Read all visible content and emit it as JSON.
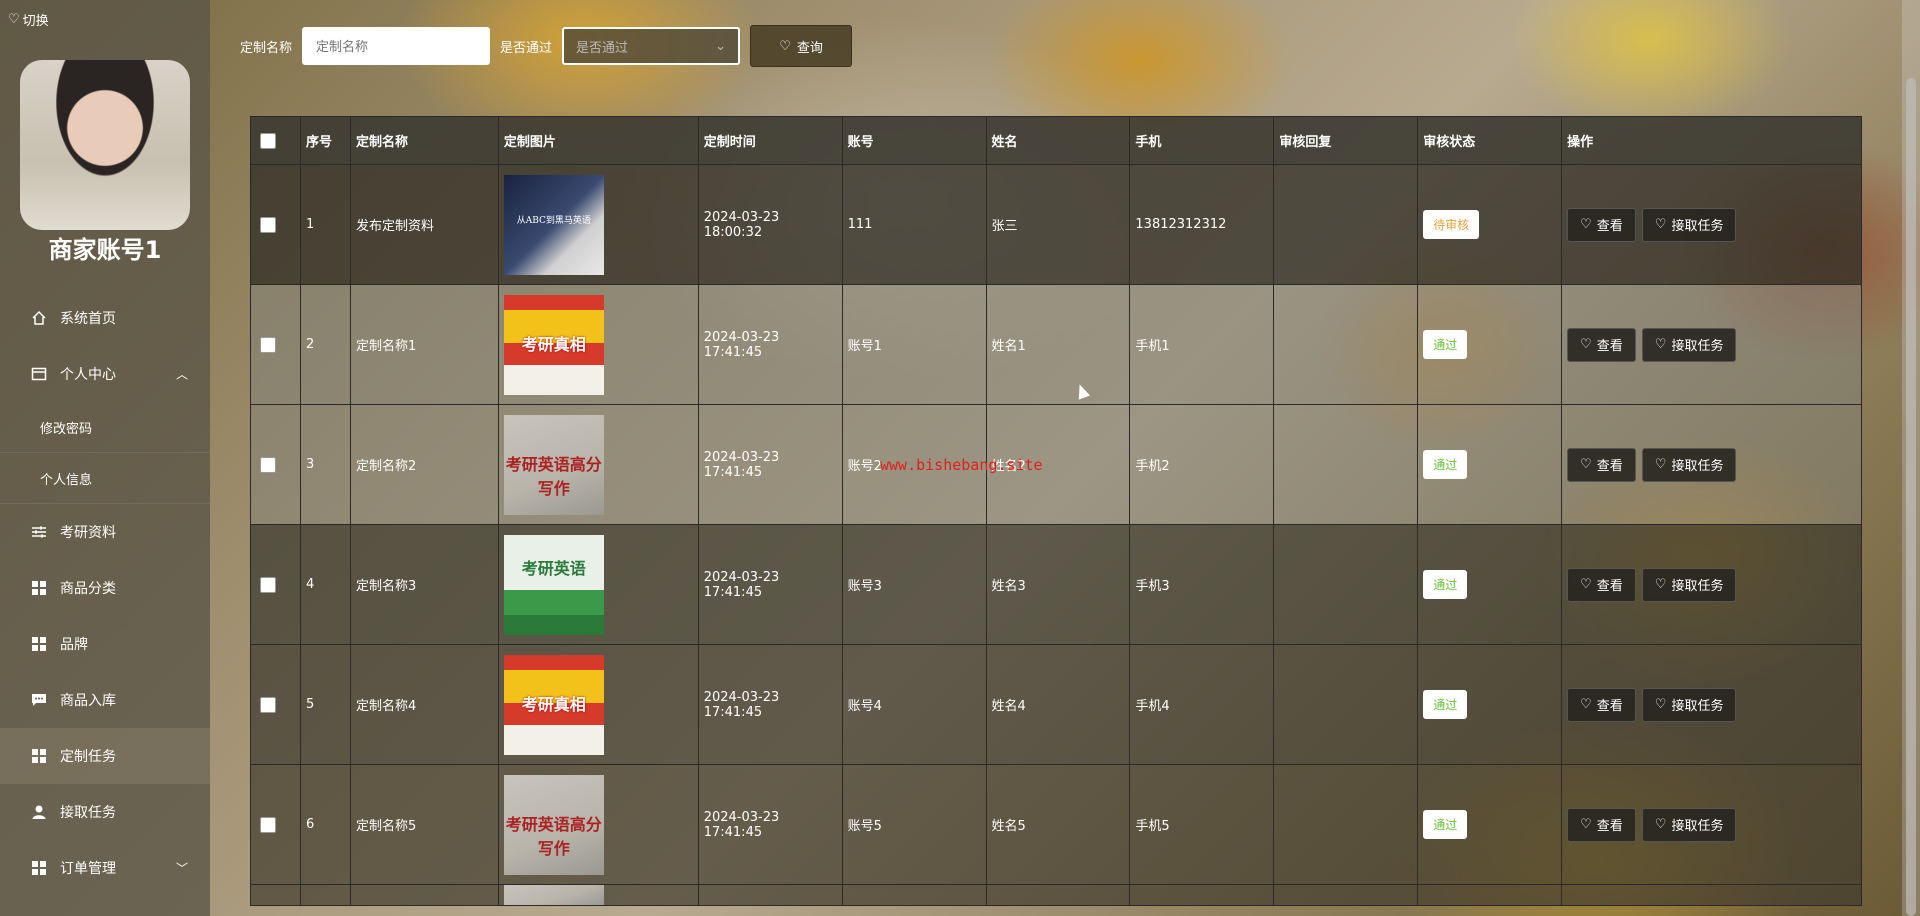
{
  "sidebar": {
    "switch_label": "切换",
    "account_name": "商家账号1",
    "items": [
      {
        "label": "系统首页",
        "icon": "home-icon"
      },
      {
        "label": "个人中心",
        "icon": "user-center-icon"
      },
      {
        "label": "修改密码"
      },
      {
        "label": "个人信息"
      },
      {
        "label": "考研资料",
        "icon": "sliders-icon"
      },
      {
        "label": "商品分类",
        "icon": "grid-icon"
      },
      {
        "label": "品牌",
        "icon": "grid-icon"
      },
      {
        "label": "商品入库",
        "icon": "chat-icon"
      },
      {
        "label": "定制任务",
        "icon": "grid-icon"
      },
      {
        "label": "接取任务",
        "icon": "person-icon"
      },
      {
        "label": "订单管理",
        "icon": "grid-icon"
      }
    ]
  },
  "search": {
    "name_label": "定制名称",
    "name_placeholder": "定制名称",
    "pass_label": "是否通过",
    "pass_placeholder": "是否通过",
    "query_label": "查询"
  },
  "table": {
    "headers": [
      "序号",
      "定制名称",
      "定制图片",
      "定制时间",
      "账号",
      "姓名",
      "手机",
      "审核回复",
      "审核状态",
      "操作"
    ],
    "rows": [
      {
        "no": "1",
        "name": "发布定制资料",
        "image": "从ABC到黑马英语",
        "time": "2024-03-23 18:00:32",
        "account": "111",
        "person": "张三",
        "phone": "13812312312",
        "reply": "",
        "status": "待审核"
      },
      {
        "no": "2",
        "name": "定制名称1",
        "image": "考研真相",
        "time": "2024-03-23 17:41:45",
        "account": "账号1",
        "person": "姓名1",
        "phone": "手机1",
        "reply": "",
        "status": "通过"
      },
      {
        "no": "3",
        "name": "定制名称2",
        "image": "考研英语高分写作",
        "time": "2024-03-23 17:41:45",
        "account": "账号2",
        "person": "姓名2",
        "phone": "手机2",
        "reply": "",
        "status": "通过"
      },
      {
        "no": "4",
        "name": "定制名称3",
        "image": "考研英语",
        "time": "2024-03-23 17:41:45",
        "account": "账号3",
        "person": "姓名3",
        "phone": "手机3",
        "reply": "",
        "status": "通过"
      },
      {
        "no": "5",
        "name": "定制名称4",
        "image": "考研真相",
        "time": "2024-03-23 17:41:45",
        "account": "账号4",
        "person": "姓名4",
        "phone": "手机4",
        "reply": "",
        "status": "通过"
      },
      {
        "no": "6",
        "name": "定制名称5",
        "image": "考研英语高分写作",
        "time": "2024-03-23 17:41:45",
        "account": "账号5",
        "person": "姓名5",
        "phone": "手机5",
        "reply": "",
        "status": "通过"
      }
    ],
    "actions": {
      "view": "查看",
      "take": "接取任务"
    }
  },
  "watermark": "www.bishebang.site",
  "colors": {
    "pending": "#e6a23c",
    "pass": "#67c23a"
  }
}
